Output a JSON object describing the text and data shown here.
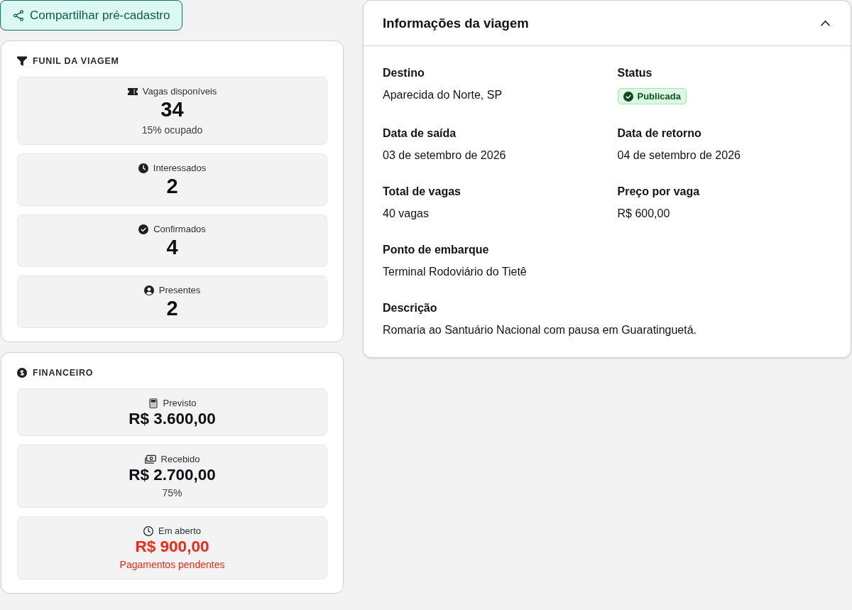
{
  "share_button": {
    "label": "Compartilhar pré-cadastro"
  },
  "funnel": {
    "title": "FUNIL DA VIAGEM",
    "stats": [
      {
        "label": "Vagas disponíveis",
        "value": "34",
        "note": "15% ocupado",
        "color": "#0d0f14"
      },
      {
        "label": "Interessados",
        "value": "2",
        "color": "#0d0f14"
      },
      {
        "label": "Confirmados",
        "value": "4",
        "color": "#0d0f14"
      },
      {
        "label": "Presentes",
        "value": "2",
        "color": "#0d0f14"
      }
    ]
  },
  "financial": {
    "title": "FINANCEIRO",
    "stats": [
      {
        "label": "Previsto",
        "value": "R$ 3.600,00",
        "color": "#0d0f14"
      },
      {
        "label": "Recebido",
        "value": "R$ 2.700,00",
        "note": "75%",
        "color": "#0d0f14"
      },
      {
        "label": "Em aberto",
        "value": "R$ 900,00",
        "note": "Pagamentos pendentes",
        "color": "#ee2a16"
      }
    ]
  },
  "trip_info": {
    "title": "Informações da viagem",
    "expanded": true,
    "rows": [
      [
        {
          "label": "Destino",
          "kind": "text",
          "value": "Aparecida do Norte, SP"
        },
        {
          "label": "Status",
          "kind": "badge",
          "value": "Publicada"
        }
      ],
      [
        {
          "label": "Data de saída",
          "kind": "text",
          "value": "03 de setembro de 2026"
        },
        {
          "label": "Data de retorno",
          "kind": "text",
          "value": "04 de setembro de 2026"
        }
      ],
      [
        {
          "label": "Total de vagas",
          "kind": "text",
          "value": "40 vagas"
        },
        {
          "label": "Preço por vaga",
          "kind": "text",
          "value": "R$ 600,00"
        }
      ],
      [
        {
          "label": "Ponto de embarque",
          "kind": "text",
          "value": "Terminal Rodoviário do Tietê"
        }
      ],
      [
        {
          "label": "Descrição",
          "kind": "text",
          "value": "Romaria ao Santuário Nacional com pausa em Guaratinguetá."
        }
      ]
    ]
  }
}
